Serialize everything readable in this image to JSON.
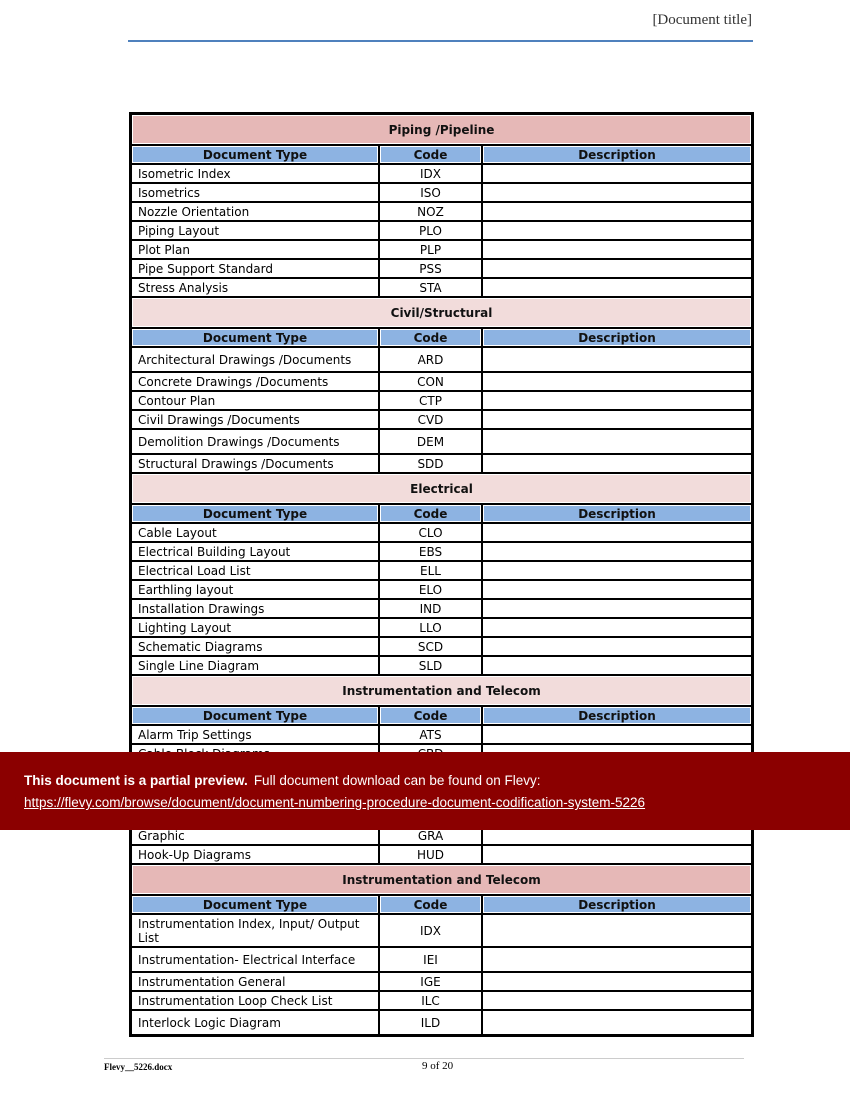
{
  "header": {
    "title": "[Document title]"
  },
  "columns": [
    "Document Type",
    "Code",
    "Description"
  ],
  "sections": [
    {
      "title": "Piping /Pipeline",
      "tone": "dark",
      "rows": [
        [
          "Isometric Index",
          "IDX",
          ""
        ],
        [
          "Isometrics",
          "ISO",
          ""
        ],
        [
          "Nozzle Orientation",
          "NOZ",
          ""
        ],
        [
          "Piping Layout",
          "PLO",
          ""
        ],
        [
          "Plot Plan",
          "PLP",
          ""
        ],
        [
          "Pipe Support Standard",
          "PSS",
          ""
        ],
        [
          "Stress Analysis",
          "STA",
          ""
        ]
      ]
    },
    {
      "title": "Civil/Structural",
      "tone": "light",
      "rows": [
        [
          "Architectural Drawings /Documents",
          "ARD",
          ""
        ],
        [
          "Concrete Drawings /Documents",
          "CON",
          ""
        ],
        [
          "Contour Plan",
          "CTP",
          ""
        ],
        [
          "Civil Drawings /Documents",
          "CVD",
          ""
        ],
        [
          "Demolition Drawings /Documents",
          "DEM",
          ""
        ],
        [
          "Structural Drawings /Documents",
          "SDD",
          ""
        ]
      ]
    },
    {
      "title": "Electrical",
      "tone": "light",
      "rows": [
        [
          "Cable Layout",
          "CLO",
          ""
        ],
        [
          "Electrical Building Layout",
          "EBS",
          ""
        ],
        [
          "Electrical Load List",
          "ELL",
          ""
        ],
        [
          "Earthling layout",
          "ELO",
          ""
        ],
        [
          "Installation Drawings",
          "IND",
          ""
        ],
        [
          "Lighting Layout",
          "LLO",
          ""
        ],
        [
          "Schematic Diagrams",
          "SCD",
          ""
        ],
        [
          "Single Line Diagram",
          "SLD",
          ""
        ]
      ]
    },
    {
      "title": "Instrumentation and Telecom",
      "tone": "light",
      "rows": [
        [
          "Alarm Trip Settings",
          "ATS",
          ""
        ],
        [
          "Cable Block Diagrams",
          "CBD",
          ""
        ],
        [
          "Graphic",
          "GRA",
          ""
        ],
        [
          "Hook-Up Diagrams",
          "HUD",
          ""
        ]
      ]
    },
    {
      "title": "Instrumentation and Telecom",
      "tone": "dark",
      "rows": [
        [
          "Instrumentation Index, Input/ Output List",
          "IDX",
          ""
        ],
        [
          "Instrumentation- Electrical  Interface",
          "IEI",
          ""
        ],
        [
          "Instrumentation General",
          "IGE",
          ""
        ],
        [
          "Instrumentation Loop Check List",
          "ILC",
          ""
        ],
        [
          "Interlock Logic Diagram",
          "ILD",
          ""
        ]
      ]
    }
  ],
  "banner": {
    "bold": "This document is a partial preview.",
    "text": "Full document download can be found on Flevy:",
    "link": "https://flevy.com/browse/document/document-numbering-procedure-document-codification-system-5226"
  },
  "footer": {
    "file": "Flevy__5226.docx",
    "page": "9 of 20"
  },
  "colors": {
    "section_dark": "#e6b8b7",
    "section_light": "#f2dcdb",
    "column_header": "#8db3e2",
    "banner": "#8b0000",
    "rule": "#4f81bd"
  }
}
